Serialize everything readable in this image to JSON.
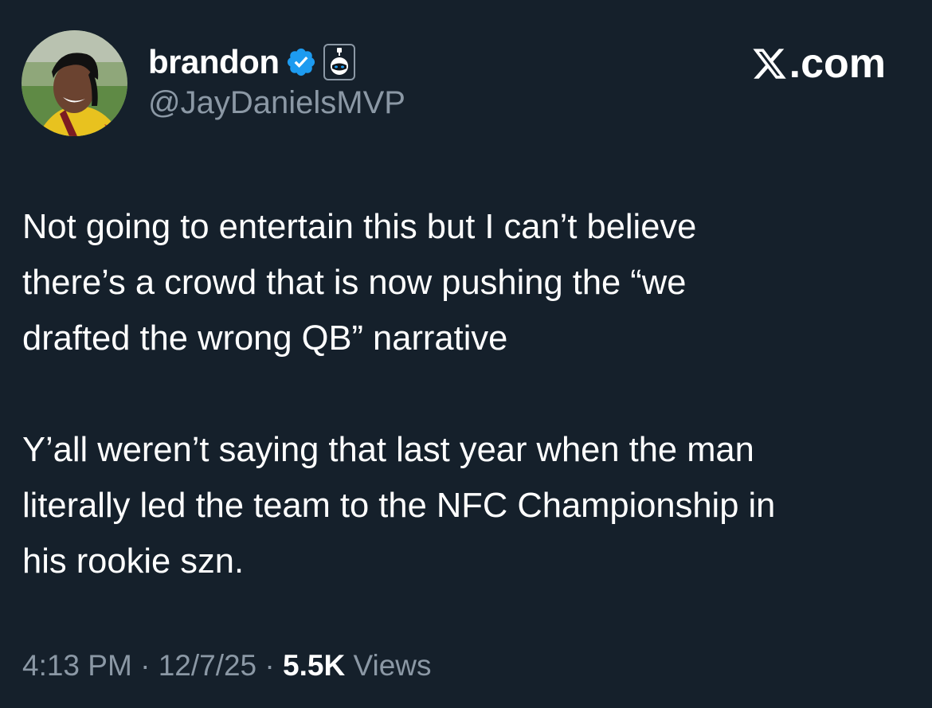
{
  "author": {
    "display_name": "brandon",
    "handle": "@JayDanielsMVP",
    "verified_badge_icon": "verified-check-icon",
    "affiliate_badge_icon": "affiliate-badge-icon",
    "badge_color": "#1d9bf0"
  },
  "site": {
    "logo_icon": "x-logo-icon",
    "suffix": ".com"
  },
  "tweet": {
    "paragraphs": [
      "Not going to entertain this but I can’t believe\nthere’s a crowd that is now pushing the “we\ndrafted the wrong QB” narrative",
      "Y’all weren’t saying that last year when the man\nliterally led the team to the NFC Championship in\nhis rookie szn."
    ]
  },
  "meta": {
    "time": "4:13 PM",
    "separator": " · ",
    "date": "12/7/25",
    "views_count": "5.5K",
    "views_label": " Views"
  },
  "colors": {
    "background": "#15202b",
    "primary_text": "#ffffff",
    "secondary_text": "#8b98a5"
  }
}
